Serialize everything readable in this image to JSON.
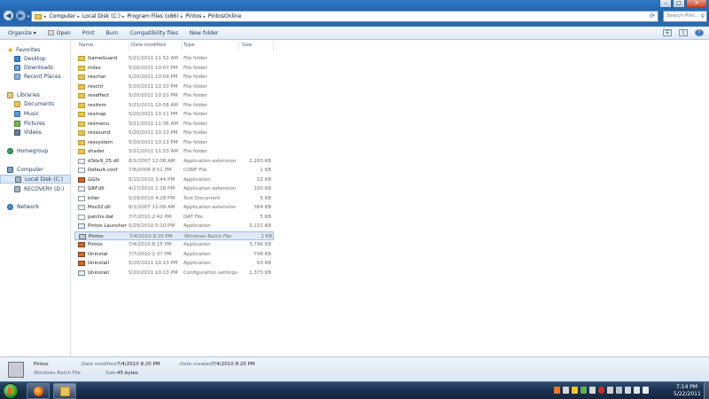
{
  "window": {
    "buttons": {
      "minimize": "–",
      "maximize": "□",
      "close": "✕"
    }
  },
  "address": {
    "crumbs": [
      "Computer",
      "Local Disk (C:)",
      "Program Files (x86)",
      "Pintos",
      "PintosOnline"
    ],
    "search_placeholder": "Search Pint..."
  },
  "toolbar": {
    "organize": "Organize ▾",
    "open": "Open",
    "print": "Print",
    "burn": "Burn",
    "compat": "Compatibility files",
    "new_folder": "New folder"
  },
  "sidebar": {
    "favorites": "Favorites",
    "fav_items": [
      "Desktop",
      "Downloads",
      "Recent Places"
    ],
    "libraries": "Libraries",
    "lib_items": [
      "Documents",
      "Music",
      "Pictures",
      "Videos"
    ],
    "homegroup": "Homegroup",
    "computer": "Computer",
    "comp_items": [
      "Local Disk (C:)",
      "RECOVERY (D:)"
    ],
    "network": "Network"
  },
  "columns": {
    "name": "Name",
    "date": "Date modified",
    "type": "Type",
    "size": "Size"
  },
  "files": [
    {
      "name": "GameGuard",
      "date": "5/21/2011 11:52 AM",
      "type": "File folder",
      "size": "",
      "icon": "folder"
    },
    {
      "name": "miles",
      "date": "5/20/2011 10:07 PM",
      "type": "File folder",
      "size": "",
      "icon": "folder"
    },
    {
      "name": "reschar",
      "date": "5/20/2011 10:09 PM",
      "type": "File folder",
      "size": "",
      "icon": "folder"
    },
    {
      "name": "resctrl",
      "date": "5/20/2011 10:10 PM",
      "type": "File folder",
      "size": "",
      "icon": "folder"
    },
    {
      "name": "reseffect",
      "date": "5/20/2011 10:10 PM",
      "type": "File folder",
      "size": "",
      "icon": "folder"
    },
    {
      "name": "resitem",
      "date": "5/21/2011 10:58 AM",
      "type": "File folder",
      "size": "",
      "icon": "folder"
    },
    {
      "name": "resmap",
      "date": "5/20/2011 10:11 PM",
      "type": "File folder",
      "size": "",
      "icon": "folder"
    },
    {
      "name": "resmenu",
      "date": "5/21/2011 11:36 AM",
      "type": "File folder",
      "size": "",
      "icon": "folder"
    },
    {
      "name": "ressound",
      "date": "5/20/2011 10:13 PM",
      "type": "File folder",
      "size": "",
      "icon": "folder"
    },
    {
      "name": "ressystem",
      "date": "5/20/2011 10:13 PM",
      "type": "File folder",
      "size": "",
      "icon": "folder"
    },
    {
      "name": "shader",
      "date": "5/21/2011 11:53 AM",
      "type": "File folder",
      "size": "",
      "icon": "folder"
    },
    {
      "name": "d3dx9_25.dll",
      "date": "8/1/2007 12:08 AM",
      "type": "Application extension",
      "size": "2,283 KB",
      "icon": "dll"
    },
    {
      "name": "Default.conf",
      "date": "7/8/2008 9:51 PM",
      "type": "CONF File",
      "size": "1 KB",
      "icon": "conf"
    },
    {
      "name": "GGfx",
      "date": "5/15/2010 3:44 PM",
      "type": "Application",
      "size": "52 KB",
      "icon": "app"
    },
    {
      "name": "GRF.dll",
      "date": "4/27/2010 1:18 PM",
      "type": "Application extension",
      "size": "100 KB",
      "icon": "dll"
    },
    {
      "name": "killer",
      "date": "5/29/2010 4:28 PM",
      "type": "Text Document",
      "size": "5 KB",
      "icon": "txt"
    },
    {
      "name": "Mss32.dll",
      "date": "8/1/2007 12:08 AM",
      "type": "Application extension",
      "size": "364 KB",
      "icon": "dll"
    },
    {
      "name": "patchs.dat",
      "date": "7/7/2010 2:42 PM",
      "type": "DAT File",
      "size": "5 KB",
      "icon": "dat"
    },
    {
      "name": "Pintos Launcher",
      "date": "5/29/2010 5:10 PM",
      "type": "Application",
      "size": "3,221 KB",
      "icon": "cfg"
    },
    {
      "name": "Pintos",
      "date": "7/4/2010 8:20 PM",
      "type": "Windows Batch File",
      "size": "1 KB",
      "icon": "bat",
      "selected": true
    },
    {
      "name": "Pintos",
      "date": "7/4/2010 8:15 PM",
      "type": "Application",
      "size": "3,796 KB",
      "icon": "app"
    },
    {
      "name": "Uninstal",
      "date": "7/7/2010 2:37 PM",
      "type": "Application",
      "size": "748 KB",
      "icon": "app"
    },
    {
      "name": "Uninstall",
      "date": "5/20/2011 10:13 PM",
      "type": "Application",
      "size": "63 KB",
      "icon": "app"
    },
    {
      "name": "Uninstall",
      "date": "5/20/2011 10:13 PM",
      "type": "Configuration settings",
      "size": "1,373 KB",
      "icon": "cfg"
    }
  ],
  "details": {
    "name": "Pintos",
    "type": "Windows Batch File",
    "modified_label": "Date modified:",
    "modified_value": "7/4/2010 8:20 PM",
    "created_label": "Date created:",
    "created_value": "7/4/2010 8:20 PM",
    "size_label": "Size:",
    "size_value": "45 bytes"
  },
  "taskbar": {
    "time": "7:14 PM",
    "date": "5/22/2011"
  }
}
